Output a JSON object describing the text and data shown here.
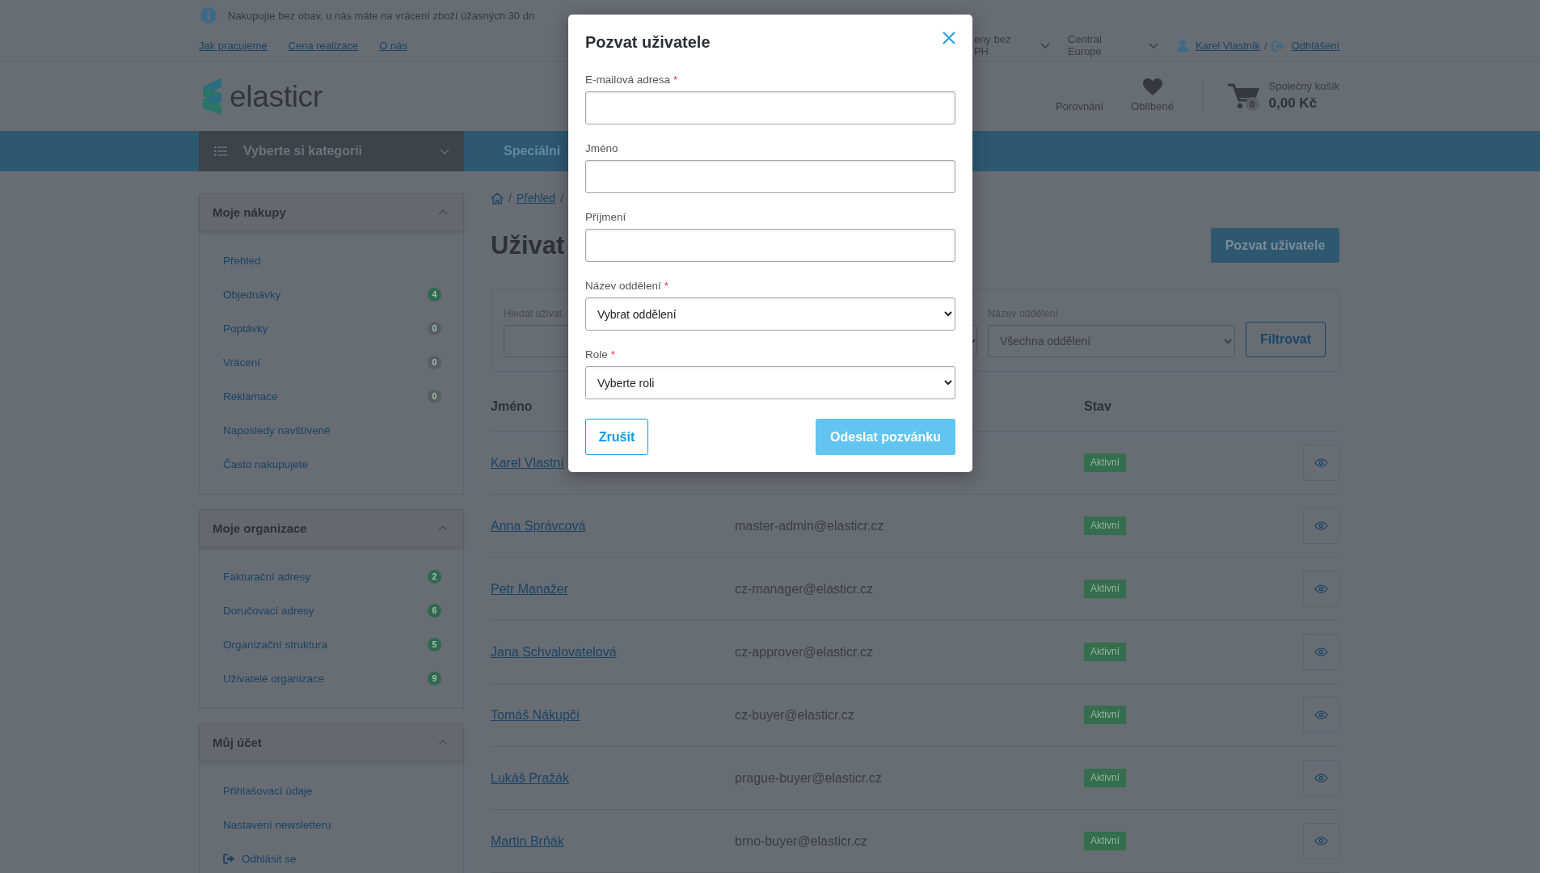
{
  "info_bar": {
    "text": "Nakupujte bez obav, u nás máte na vrácení zboží úžasných 30 dn"
  },
  "top_links": [
    "Jak pracujeme",
    "Cena realizace",
    "O nás"
  ],
  "price_mode": "eny bez PH",
  "region": "Central Europe",
  "account": {
    "user": "Karel Vlastník",
    "separator": "/",
    "logout": "Odhlášení"
  },
  "logo": "elasticr",
  "header_actions": [
    {
      "kind": "compare",
      "label": "Porovnání"
    },
    {
      "kind": "favorites",
      "label": "Oblíbené"
    }
  ],
  "cart": {
    "count": "0",
    "title": "Společný košík",
    "total": "0,00 Kč"
  },
  "category_menu": "Vyberte si kategorii",
  "nav_links": [
    "Speciální"
  ],
  "sidebar": [
    {
      "title": "Moje nákupy",
      "expanded": true,
      "items": [
        {
          "kind": "link",
          "label": "Přehled"
        },
        {
          "kind": "link",
          "label": "Objednávky",
          "badge": "4",
          "color": "#2f6a50"
        },
        {
          "kind": "link",
          "label": "Poptávky",
          "badge": "0",
          "color": "#5a5e64"
        },
        {
          "kind": "link",
          "label": "Vrácení",
          "badge": "0",
          "color": "#5a5e64"
        },
        {
          "kind": "link",
          "label": "Reklamace",
          "badge": "0",
          "color": "#5a5e64"
        },
        {
          "kind": "link",
          "label": "Naposledy navštívené"
        },
        {
          "kind": "link",
          "label": "Často nakupujete"
        }
      ]
    },
    {
      "title": "Moje organizace",
      "expanded": true,
      "items": [
        {
          "kind": "link",
          "label": "Fakturační adresy",
          "badge": "2",
          "color": "#2f6a50"
        },
        {
          "kind": "link",
          "label": "Doručovací adresy",
          "badge": "6",
          "color": "#2f6a50"
        },
        {
          "kind": "link",
          "label": "Organizační struktura",
          "badge": "5",
          "color": "#2f6a50"
        },
        {
          "kind": "link",
          "label": "Uživatelé organizace",
          "badge": "9",
          "color": "#2f6a50"
        }
      ]
    },
    {
      "title": "Můj účet",
      "expanded": true,
      "items": [
        {
          "kind": "link",
          "label": "Přihlašovací údaje"
        },
        {
          "kind": "link",
          "label": "Nastavení newsletteru"
        },
        {
          "kind": "logout",
          "label": "Odhlásit se"
        }
      ]
    }
  ],
  "breadcrumb": [
    {
      "kind": "home"
    },
    {
      "kind": "separator",
      "text": "/"
    },
    {
      "kind": "link",
      "text": "Přehled"
    },
    {
      "kind": "separator",
      "text": "/"
    }
  ],
  "page_title": "Uživat",
  "invite_button": "Pozvat uživatele",
  "filter": {
    "search_label": "Hledat uživat",
    "department_label": "Název oddělení",
    "department_value": "Všechna oddělení",
    "button": "Filtrovat"
  },
  "table": {
    "columns": [
      {
        "kind": "name",
        "label": "Jméno"
      },
      {
        "kind": "status",
        "label": "Stav"
      }
    ],
    "rows": [
      {
        "name": "Karel Vlastní",
        "status": "Aktivní"
      },
      {
        "name": "Anna Správcová",
        "email": "master-admin@elasticr.cz",
        "status": "Aktivní"
      },
      {
        "name": "Petr Manažer",
        "email": "cz-manager@elasticr.cz",
        "status": "Aktivní"
      },
      {
        "name": "Jana Schvalovatelová",
        "email": "cz-approver@elasticr.cz",
        "status": "Aktivní"
      },
      {
        "name": "Tomáš Nákupčí",
        "email": "cz-buyer@elasticr.cz",
        "status": "Aktivní"
      },
      {
        "name": "Lukáš Pražák",
        "email": "prague-buyer@elasticr.cz",
        "status": "Aktivní"
      },
      {
        "name": "Martin Brňák",
        "email": "brno-buyer@elasticr.cz",
        "status": "Aktivní"
      }
    ]
  },
  "modal": {
    "title": "Pozvat uživatele",
    "fields": [
      {
        "kind": "input",
        "label": "E-mailová adresa",
        "required_mark": "*"
      },
      {
        "kind": "input",
        "label": "Jméno"
      },
      {
        "kind": "input",
        "label": "Příjmení"
      },
      {
        "kind": "select",
        "label": "Název oddělení",
        "required_mark": "*",
        "value": "Vybrat oddělení"
      },
      {
        "kind": "select",
        "label": "Role",
        "required_mark": "*",
        "value": "Vyberte roli"
      }
    ],
    "cancel": "Zrušit",
    "submit": "Odeslat pozvánku"
  }
}
